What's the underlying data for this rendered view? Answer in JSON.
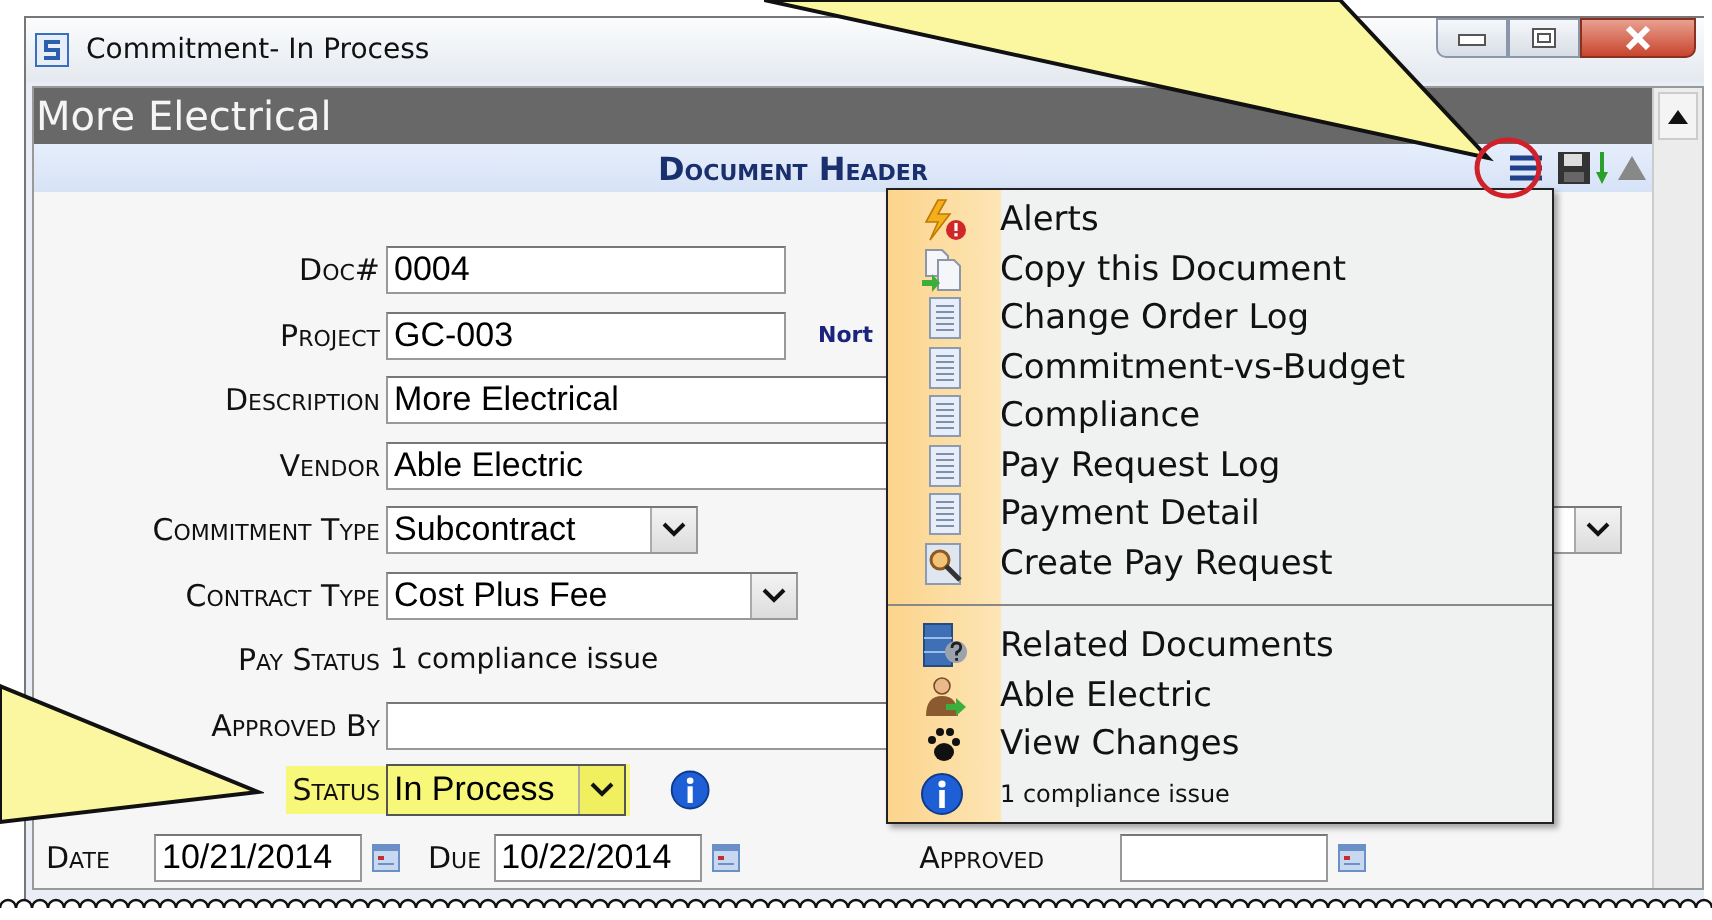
{
  "window": {
    "title": "Commitment- In Process"
  },
  "document": {
    "title": "More Electrical"
  },
  "section": {
    "title": "Document Header"
  },
  "fields": [
    {
      "kind": "text",
      "label": "Doc#",
      "value": "0004"
    },
    {
      "kind": "text",
      "label": "Project",
      "value": "GC-003",
      "note": "Nort"
    },
    {
      "kind": "text",
      "label": "Description",
      "value": "More Electrical"
    },
    {
      "kind": "text",
      "label": "Vendor",
      "value": "Able Electric"
    },
    {
      "kind": "select",
      "label": "Commitment Type",
      "value": "Subcontract"
    },
    {
      "kind": "select",
      "label": "Contract Type",
      "value": "Cost Plus Fee"
    },
    {
      "kind": "readonly",
      "label": "Pay Status",
      "value": "1 compliance issue"
    },
    {
      "kind": "text",
      "label": "Approved By"
    },
    {
      "kind": "status",
      "label": "Status",
      "value": "In Process",
      "highlighted": true
    }
  ],
  "dates": [
    {
      "label": "Date",
      "value": "10/21/2014"
    },
    {
      "label": "Due",
      "value": "10/22/2014"
    },
    {
      "label": "Approved"
    }
  ],
  "menu": {
    "groups": [
      [
        {
          "kind": "alert",
          "label": "Alerts"
        },
        {
          "kind": "copy",
          "label": "Copy this Document"
        },
        {
          "kind": "report",
          "label": "Change Order Log"
        },
        {
          "kind": "report",
          "label": "Commitment-vs-Budget"
        },
        {
          "kind": "report",
          "label": "Compliance"
        },
        {
          "kind": "report",
          "label": "Pay Request Log"
        },
        {
          "kind": "report",
          "label": "Payment Detail"
        },
        {
          "kind": "search",
          "label": "Create Pay Request"
        }
      ],
      [
        {
          "kind": "related",
          "label": "Related Documents"
        },
        {
          "kind": "vendor",
          "label": "Able Electric"
        },
        {
          "kind": "changes",
          "label": "View Changes"
        },
        {
          "kind": "info",
          "label": "1 compliance issue"
        }
      ]
    ]
  }
}
